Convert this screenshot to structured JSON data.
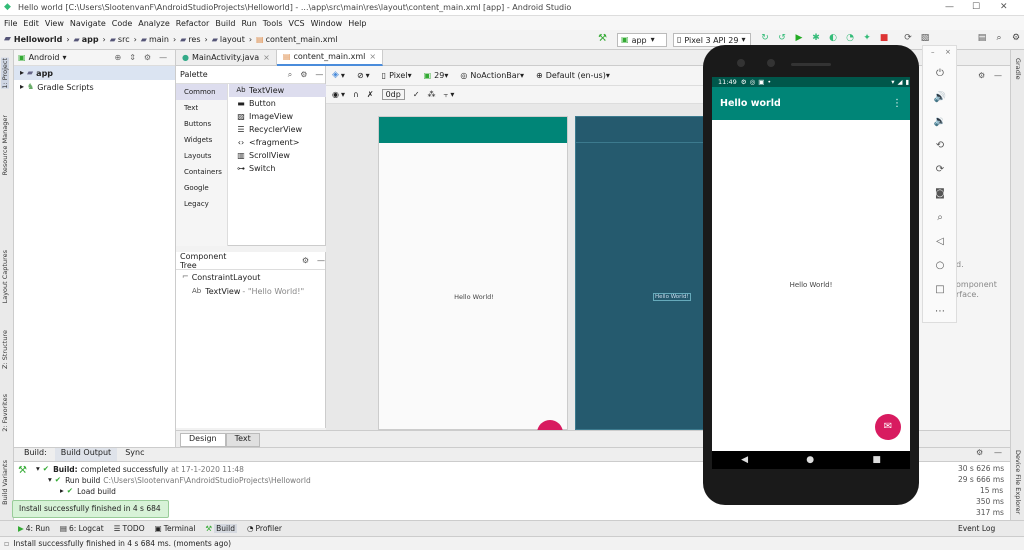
{
  "window": {
    "title": "Hello world [C:\\Users\\SlootenvanF\\AndroidStudioProjects\\Helloworld] - ...\\app\\src\\main\\res\\layout\\content_main.xml [app] - Android Studio"
  },
  "menu": [
    "File",
    "Edit",
    "View",
    "Navigate",
    "Code",
    "Analyze",
    "Refactor",
    "Build",
    "Run",
    "Tools",
    "VCS",
    "Window",
    "Help"
  ],
  "breadcrumb": [
    "Helloworld",
    "app",
    "src",
    "main",
    "res",
    "layout",
    "content_main.xml"
  ],
  "toolbar": {
    "config": "app",
    "device": "Pixel 3 API 29"
  },
  "project": {
    "view": "Android",
    "items": [
      "app",
      "Gradle Scripts"
    ]
  },
  "editor_tabs": [
    "MainActivity.java",
    "content_main.xml"
  ],
  "palette": {
    "title": "Palette",
    "categories": [
      "Common",
      "Text",
      "Buttons",
      "Widgets",
      "Layouts",
      "Containers",
      "Google",
      "Legacy"
    ],
    "items": [
      "TextView",
      "Button",
      "ImageView",
      "RecyclerView",
      "<fragment>",
      "ScrollView",
      "Switch"
    ]
  },
  "component_tree": {
    "title": "Component Tree",
    "root": "ConstraintLayout",
    "child": "TextView",
    "child_hint": "- \"Hello World!\"",
    "child_prefix": "Ab"
  },
  "design_toolbar": {
    "device": "Pixel",
    "api": "29",
    "theme": "NoActionBar",
    "locale": "Default (en-us)",
    "margin": "0dp"
  },
  "canvas": {
    "text1": "Hello World!",
    "text2": "Hello World!"
  },
  "design_tabs": [
    "Design",
    "Text"
  ],
  "right_panel": {
    "frag1": "d.",
    "frag2": "omponent",
    "frag3": "rface."
  },
  "build": {
    "tabs": [
      "Build:",
      "Build Output",
      "Sync"
    ],
    "lines": [
      {
        "label": "Build:",
        "text": "completed successfully",
        "suffix": "at 17-1-2020 11:48",
        "time": "30 s 626 ms"
      },
      {
        "label": "Run build",
        "text": "C:\\Users\\SlootenvanF\\AndroidStudioProjects\\Helloworld",
        "suffix": "",
        "time": "29 s 666 ms"
      },
      {
        "label": "Load build",
        "text": "",
        "suffix": "",
        "time": "15 ms"
      },
      {
        "label": "",
        "text": "",
        "suffix": "",
        "time": "350 ms"
      },
      {
        "label": "",
        "text": "",
        "suffix": "",
        "time": "317 ms"
      }
    ]
  },
  "bottom_tools": [
    "4: Run",
    "6: Logcat",
    "TODO",
    "Terminal",
    "Build",
    "Profiler"
  ],
  "event_log": "Event Log",
  "toast": "Install successfully finished in 4 s 684 ms.",
  "status": "Install successfully finished in 4 s 684 ms. (moments ago)",
  "left_tabs": [
    "1: Project",
    "Resource Manager",
    "Layout Captures",
    "Z: Structure",
    "2: Favorites",
    "Build Variants"
  ],
  "right_tabs": [
    "Gradle",
    "Device File Explorer"
  ],
  "phone": {
    "time": "11:49",
    "app_title": "Hello world",
    "content": "Hello World!"
  },
  "colors": {
    "accent": "#008577",
    "accent_dark": "#00574B",
    "fab": "#D81B60",
    "blueprint": "#255a6e"
  }
}
